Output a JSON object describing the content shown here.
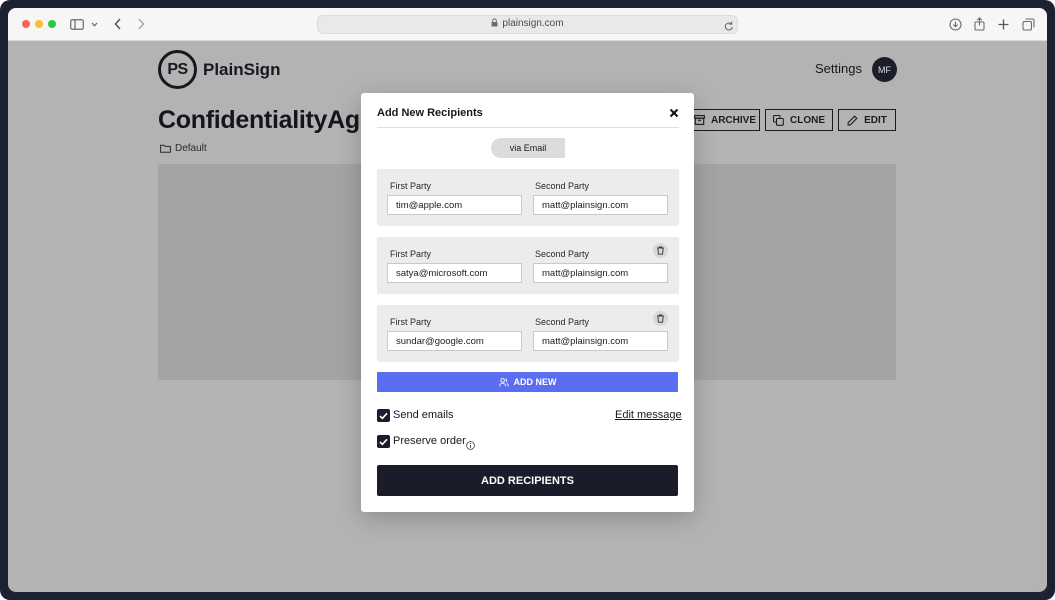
{
  "browser": {
    "url": "plainsign.com",
    "icons": [
      "sidebar-icon",
      "chevron-down-icon",
      "back-icon",
      "forward-icon",
      "lock-icon",
      "reload-icon",
      "download-icon",
      "share-icon",
      "new-tab-icon",
      "tabs-overview-icon"
    ]
  },
  "app": {
    "logo_mark": "PS",
    "logo_text": "PlainSign",
    "settings_label": "Settings",
    "avatar_initials": "MF"
  },
  "document": {
    "title": "ConfidentialityAgre",
    "folder": "Default",
    "actions": {
      "archive": "ARCHIVE",
      "clone": "CLONE",
      "edit": "EDIT"
    }
  },
  "modal": {
    "title": "Add New Recipients",
    "close_icon": "close-icon",
    "tab_label": "via Email",
    "rows": [
      {
        "first_label": "First Party",
        "first_value": "tim@apple.com",
        "second_label": "Second Party",
        "second_value": "matt@plainsign.com",
        "deletable": false
      },
      {
        "first_label": "First Party",
        "first_value": "satya@microsoft.com",
        "second_label": "Second Party",
        "second_value": "matt@plainsign.com",
        "deletable": true
      },
      {
        "first_label": "First Party",
        "first_value": "sundar@google.com",
        "second_label": "Second Party",
        "second_value": "matt@plainsign.com",
        "deletable": true
      }
    ],
    "add_new_label": "ADD NEW",
    "send_emails_label": "Send emails",
    "send_emails_checked": true,
    "edit_message_label": "Edit message",
    "preserve_order_label": "Preserve order",
    "preserve_order_checked": true,
    "submit_label": "ADD RECIPIENTS"
  },
  "colors": {
    "accent_blue": "#5b6df0",
    "primary_dark": "#1a1c2a",
    "overlay_gray": "#b3b3b3"
  }
}
